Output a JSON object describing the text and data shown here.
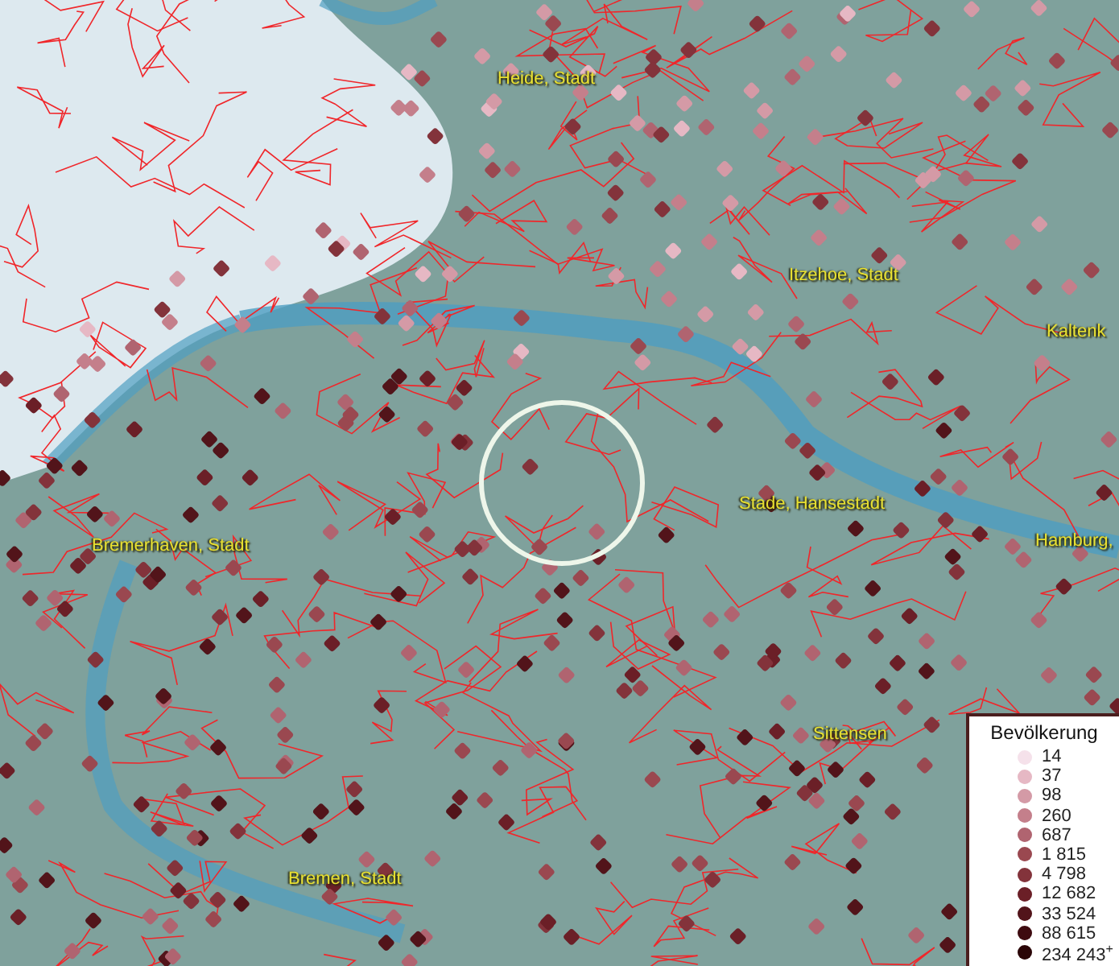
{
  "map": {
    "places": [
      {
        "name": "Heide, Stadt"
      },
      {
        "name": "Itzehoe, Stadt"
      },
      {
        "name": "Kaltenk"
      },
      {
        "name": "Stade, Hansestadt"
      },
      {
        "name": "Bremerhaven, Stadt"
      },
      {
        "name": "Hamburg,"
      },
      {
        "name": "Sittensen"
      },
      {
        "name": "Bremen, Stadt"
      }
    ]
  },
  "legend": {
    "title": "Bevölkerung",
    "items": [
      {
        "label": "14",
        "color": "#f5e1ea"
      },
      {
        "label": "37",
        "color": "#e6b8c4"
      },
      {
        "label": "98",
        "color": "#d49aa6"
      },
      {
        "label": "260",
        "color": "#c47f8b"
      },
      {
        "label": "687",
        "color": "#b06470"
      },
      {
        "label": "1 815",
        "color": "#9a4850"
      },
      {
        "label": "4 798",
        "color": "#83333b"
      },
      {
        "label": "12 682",
        "color": "#6b1f27"
      },
      {
        "label": "33 524",
        "color": "#52141a"
      },
      {
        "label": "88 615",
        "color": "#3e0b10"
      },
      {
        "label": "234 243$^{+}$",
        "color": "#2a0507"
      }
    ]
  }
}
